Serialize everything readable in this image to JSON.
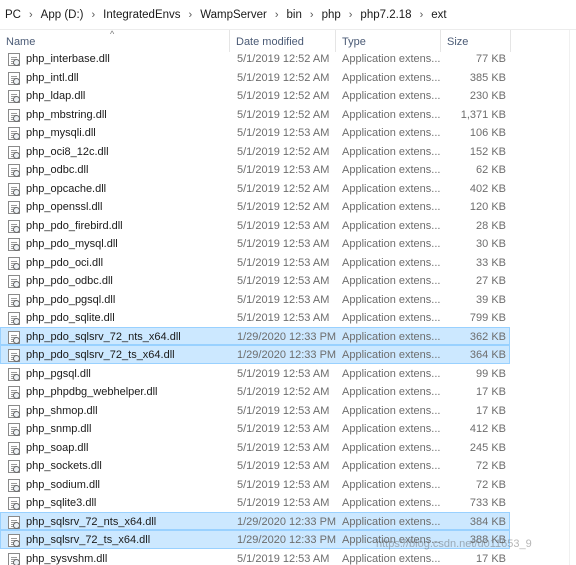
{
  "breadcrumb": [
    "PC",
    "App (D:)",
    "IntegratedEnvs",
    "WampServer",
    "bin",
    "php",
    "php7.2.18",
    "ext"
  ],
  "columns": {
    "name": "Name",
    "date": "Date modified",
    "type": "Type",
    "size": "Size"
  },
  "sort_glyph": "^",
  "files": [
    {
      "name": "php_interbase.dll",
      "date": "5/1/2019 12:52 AM",
      "type": "Application extens...",
      "size": "77 KB",
      "selected": false
    },
    {
      "name": "php_intl.dll",
      "date": "5/1/2019 12:52 AM",
      "type": "Application extens...",
      "size": "385 KB",
      "selected": false
    },
    {
      "name": "php_ldap.dll",
      "date": "5/1/2019 12:52 AM",
      "type": "Application extens...",
      "size": "230 KB",
      "selected": false
    },
    {
      "name": "php_mbstring.dll",
      "date": "5/1/2019 12:52 AM",
      "type": "Application extens...",
      "size": "1,371 KB",
      "selected": false
    },
    {
      "name": "php_mysqli.dll",
      "date": "5/1/2019 12:53 AM",
      "type": "Application extens...",
      "size": "106 KB",
      "selected": false
    },
    {
      "name": "php_oci8_12c.dll",
      "date": "5/1/2019 12:52 AM",
      "type": "Application extens...",
      "size": "152 KB",
      "selected": false
    },
    {
      "name": "php_odbc.dll",
      "date": "5/1/2019 12:53 AM",
      "type": "Application extens...",
      "size": "62 KB",
      "selected": false
    },
    {
      "name": "php_opcache.dll",
      "date": "5/1/2019 12:52 AM",
      "type": "Application extens...",
      "size": "402 KB",
      "selected": false
    },
    {
      "name": "php_openssl.dll",
      "date": "5/1/2019 12:52 AM",
      "type": "Application extens...",
      "size": "120 KB",
      "selected": false
    },
    {
      "name": "php_pdo_firebird.dll",
      "date": "5/1/2019 12:53 AM",
      "type": "Application extens...",
      "size": "28 KB",
      "selected": false
    },
    {
      "name": "php_pdo_mysql.dll",
      "date": "5/1/2019 12:53 AM",
      "type": "Application extens...",
      "size": "30 KB",
      "selected": false
    },
    {
      "name": "php_pdo_oci.dll",
      "date": "5/1/2019 12:53 AM",
      "type": "Application extens...",
      "size": "33 KB",
      "selected": false
    },
    {
      "name": "php_pdo_odbc.dll",
      "date": "5/1/2019 12:53 AM",
      "type": "Application extens...",
      "size": "27 KB",
      "selected": false
    },
    {
      "name": "php_pdo_pgsql.dll",
      "date": "5/1/2019 12:53 AM",
      "type": "Application extens...",
      "size": "39 KB",
      "selected": false
    },
    {
      "name": "php_pdo_sqlite.dll",
      "date": "5/1/2019 12:53 AM",
      "type": "Application extens...",
      "size": "799 KB",
      "selected": false
    },
    {
      "name": "php_pdo_sqlsrv_72_nts_x64.dll",
      "date": "1/29/2020 12:33 PM",
      "type": "Application extens...",
      "size": "362 KB",
      "selected": true
    },
    {
      "name": "php_pdo_sqlsrv_72_ts_x64.dll",
      "date": "1/29/2020 12:33 PM",
      "type": "Application extens...",
      "size": "364 KB",
      "selected": true
    },
    {
      "name": "php_pgsql.dll",
      "date": "5/1/2019 12:53 AM",
      "type": "Application extens...",
      "size": "99 KB",
      "selected": false
    },
    {
      "name": "php_phpdbg_webhelper.dll",
      "date": "5/1/2019 12:52 AM",
      "type": "Application extens...",
      "size": "17 KB",
      "selected": false
    },
    {
      "name": "php_shmop.dll",
      "date": "5/1/2019 12:53 AM",
      "type": "Application extens...",
      "size": "17 KB",
      "selected": false
    },
    {
      "name": "php_snmp.dll",
      "date": "5/1/2019 12:53 AM",
      "type": "Application extens...",
      "size": "412 KB",
      "selected": false
    },
    {
      "name": "php_soap.dll",
      "date": "5/1/2019 12:53 AM",
      "type": "Application extens...",
      "size": "245 KB",
      "selected": false
    },
    {
      "name": "php_sockets.dll",
      "date": "5/1/2019 12:53 AM",
      "type": "Application extens...",
      "size": "72 KB",
      "selected": false
    },
    {
      "name": "php_sodium.dll",
      "date": "5/1/2019 12:53 AM",
      "type": "Application extens...",
      "size": "72 KB",
      "selected": false
    },
    {
      "name": "php_sqlite3.dll",
      "date": "5/1/2019 12:53 AM",
      "type": "Application extens...",
      "size": "733 KB",
      "selected": false
    },
    {
      "name": "php_sqlsrv_72_nts_x64.dll",
      "date": "1/29/2020 12:33 PM",
      "type": "Application extens...",
      "size": "384 KB",
      "selected": true
    },
    {
      "name": "php_sqlsrv_72_ts_x64.dll",
      "date": "1/29/2020 12:33 PM",
      "type": "Application extens...",
      "size": "388 KB",
      "selected": true
    },
    {
      "name": "php_sysvshm.dll",
      "date": "5/1/2019 12:53 AM",
      "type": "Application extens...",
      "size": "17 KB",
      "selected": false
    }
  ],
  "watermark": "https://blog.csdn.net/u011653_9",
  "colors": {
    "selection_bg": "#cce8ff",
    "selection_border": "#99d1ff",
    "header_text": "#4a5a75"
  },
  "icons": {
    "file": "dll-file-icon",
    "sort": "sort-up-icon"
  }
}
